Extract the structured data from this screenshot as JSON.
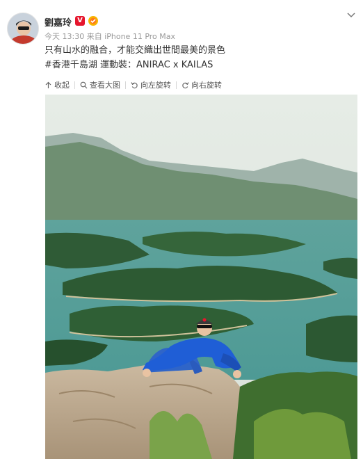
{
  "post": {
    "author": "劉嘉玲",
    "badge": "V",
    "time": "今天 13:30",
    "source": "来自 iPhone 11 Pro Max",
    "text_line1": "只有山水的融合，才能交織出世間最美的景色",
    "hashtag": "#香港千島湖",
    "text_line2_rest": " 運動裝：ANIRAC x KAILAS"
  },
  "toolbar": {
    "collapse": "收起",
    "view_large": "查看大图",
    "rotate_left": "向左旋转",
    "rotate_right": "向右旋转"
  },
  "colors": {
    "vip": "#e6162d",
    "text": "#333333",
    "meta": "#999999"
  }
}
